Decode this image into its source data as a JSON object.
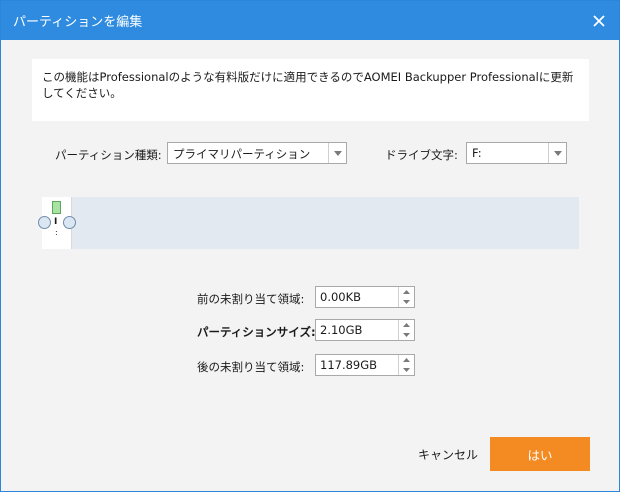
{
  "window": {
    "title": "パーティションを編集"
  },
  "notice": {
    "text": "この機能はProfessionalのような有料版だけに適用できるのでAOMEI Backupper Professionalに更新してください。"
  },
  "partition_type": {
    "label": "パーティション種類:",
    "value": "プライマリパーティション"
  },
  "drive_letter": {
    "label": "ドライブ文字:",
    "value": "F:"
  },
  "disk_map": {
    "partition_text1": "I",
    "partition_text2": ":"
  },
  "fields": [
    {
      "label": "前の未割り当て領域:",
      "value": "0.00KB"
    },
    {
      "label": "パーティションサイズ:",
      "value": "2.10GB"
    },
    {
      "label": "後の未割り当て領域:",
      "value": "117.89GB"
    }
  ],
  "buttons": {
    "cancel": "キャンセル",
    "ok": "はい"
  },
  "colors": {
    "titlebar": "#2e8be0",
    "accent": "#f48a22"
  }
}
